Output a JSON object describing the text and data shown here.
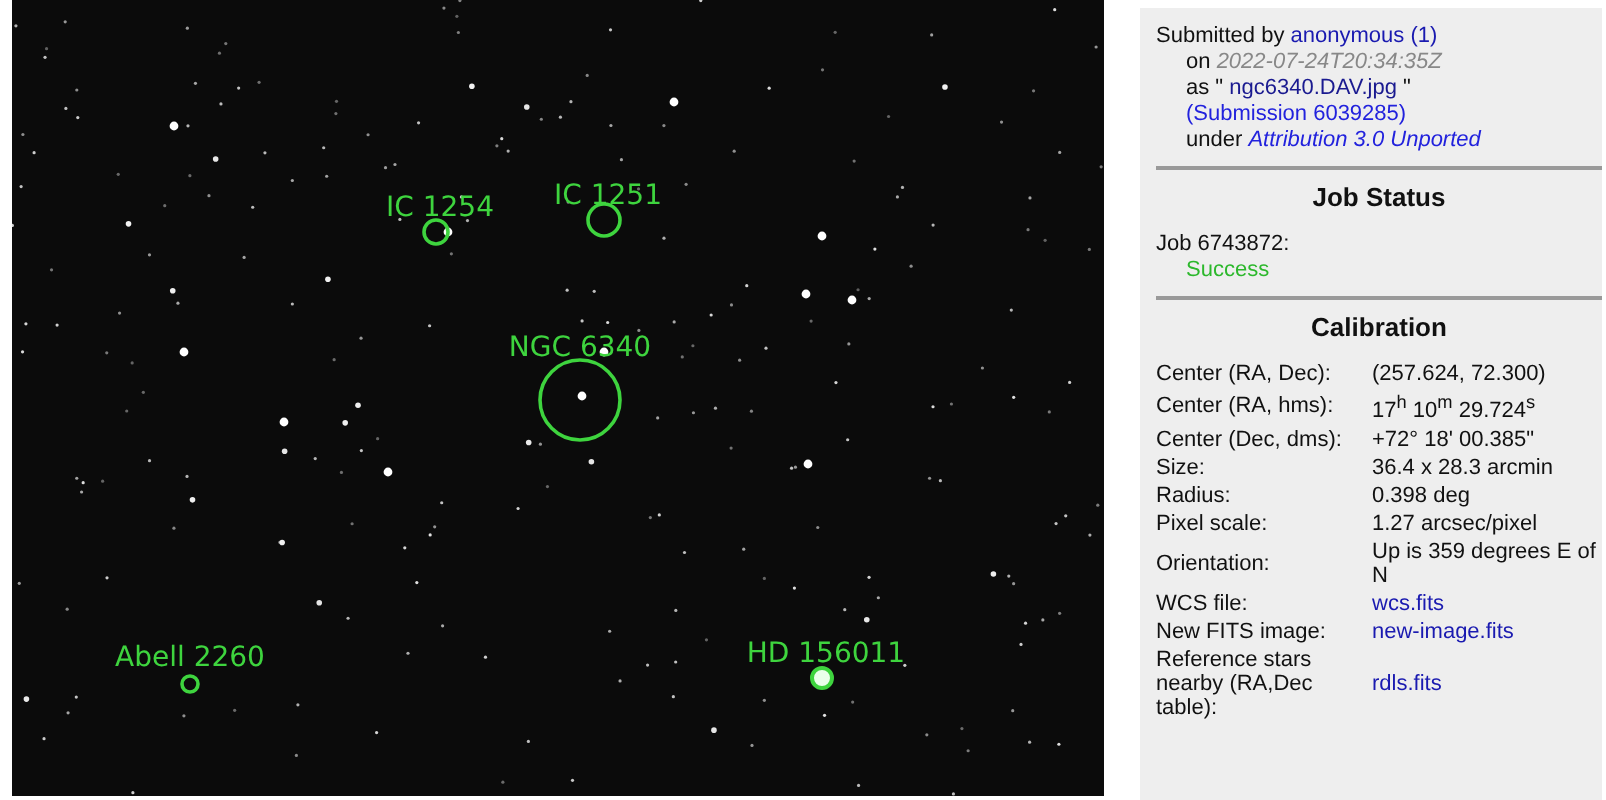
{
  "sky_image": {
    "annotations": [
      {
        "kind": "object",
        "label": "IC 1254"
      },
      {
        "kind": "object",
        "label": "IC 1251"
      },
      {
        "kind": "object",
        "label": "NGC 6340"
      },
      {
        "kind": "object",
        "label": "Abell 2260"
      },
      {
        "kind": "star",
        "label": "HD 156011"
      }
    ]
  },
  "submission": {
    "submitted_by": "Submitted by",
    "user": "anonymous (1)",
    "on": "on",
    "date": "2022-07-24T20:34:35Z",
    "as_open": "as \"",
    "file": "ngc6340.DAV.jpg",
    "as_close": "\"",
    "submission_link": "(Submission 6039285)",
    "under": "under",
    "license": "Attribution 3.0 Unported"
  },
  "job_status": {
    "title": "Job Status",
    "job": "Job 6743872:",
    "status": "Success"
  },
  "calibration": {
    "title": "Calibration",
    "rows": [
      {
        "label": "Center (RA, Dec):",
        "value": "(257.624, 72.300)",
        "kind": "text"
      },
      {
        "label": "Center (RA, hms):",
        "value": "17$^{h}$ 10$^{m}$ 29.724$^{s}$",
        "kind": "text"
      },
      {
        "label": "Center (Dec, dms):",
        "value": "+72° 18' 00.385\"",
        "kind": "text"
      },
      {
        "label": "Size:",
        "value": "36.4 x 28.3 arcmin",
        "kind": "text"
      },
      {
        "label": "Radius:",
        "value": "0.398 deg",
        "kind": "text"
      },
      {
        "label": "Pixel scale:",
        "value": "1.27 arcsec/pixel",
        "kind": "text"
      },
      {
        "label": "Orientation:",
        "value": "Up is 359 degrees E of N",
        "kind": "text"
      },
      {
        "label": "WCS file:",
        "value": "wcs.fits",
        "kind": "link"
      },
      {
        "label": "New FITS image:",
        "value": "new-image.fits",
        "kind": "link"
      },
      {
        "label": "Reference stars nearby (RA,Dec table):",
        "value": "rdls.fits",
        "kind": "link"
      }
    ]
  }
}
